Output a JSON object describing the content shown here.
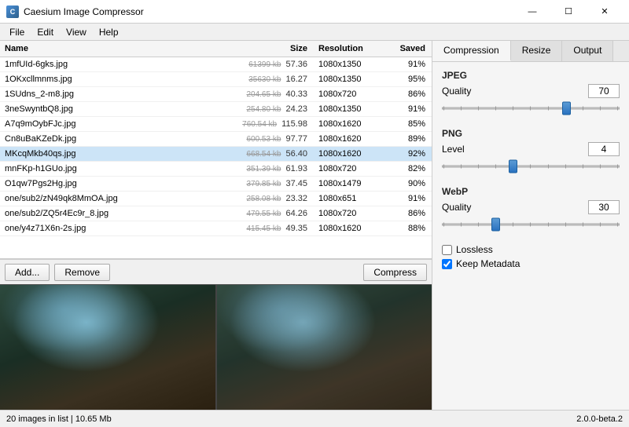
{
  "app": {
    "title": "Caesium Image Compressor",
    "version": "2.0.0-beta.2"
  },
  "titlebar": {
    "minimize": "—",
    "maximize": "☐",
    "close": "✕"
  },
  "menubar": {
    "items": [
      "File",
      "Edit",
      "View",
      "Help"
    ]
  },
  "filelist": {
    "headers": {
      "name": "Name",
      "size": "Size",
      "resolution": "Resolution",
      "saved": "Saved"
    },
    "files": [
      {
        "name": "1mfUId-6gks.jpg",
        "size_orig": "61399 kb",
        "size_new": "57.36",
        "resolution": "1080x1350",
        "saved": "91%"
      },
      {
        "name": "1OKxcllmnms.jpg",
        "size_orig": "35630 kb",
        "size_new": "16.27",
        "resolution": "1080x1350",
        "saved": "95%"
      },
      {
        "name": "1SUdns_2-m8.jpg",
        "size_orig": "204.65 kb",
        "size_new": "40.33",
        "resolution": "1080x720",
        "saved": "86%"
      },
      {
        "name": "3neSwyntbQ8.jpg",
        "size_orig": "254.80 kb",
        "size_new": "24.23",
        "resolution": "1080x1350",
        "saved": "91%"
      },
      {
        "name": "A7q9mOybFJc.jpg",
        "size_orig": "760.54 kb",
        "size_new": "115.98",
        "resolution": "1080x1620",
        "saved": "85%"
      },
      {
        "name": "Cn8uBaKZeDk.jpg",
        "size_orig": "600.53 kb",
        "size_new": "97.77",
        "resolution": "1080x1620",
        "saved": "89%"
      },
      {
        "name": "MKcqMkb40qs.jpg",
        "size_orig": "668.54 kb",
        "size_new": "56.40",
        "resolution": "1080x1620",
        "saved": "92%",
        "selected": true
      },
      {
        "name": "mnFKp-h1GUo.jpg",
        "size_orig": "351.39 kb",
        "size_new": "61.93",
        "resolution": "1080x720",
        "saved": "82%"
      },
      {
        "name": "O1qw7Pgs2Hg.jpg",
        "size_orig": "379.85 kb",
        "size_new": "37.45",
        "resolution": "1080x1479",
        "saved": "90%"
      },
      {
        "name": "one/sub2/zN49qk8MmOA.jpg",
        "size_orig": "258.08 kb",
        "size_new": "23.32",
        "resolution": "1080x651",
        "saved": "91%"
      },
      {
        "name": "one/sub2/ZQ5r4Ec9r_8.jpg",
        "size_orig": "479.55 kb",
        "size_new": "64.26",
        "resolution": "1080x720",
        "saved": "86%"
      },
      {
        "name": "one/y4z71X6n-2s.jpg",
        "size_orig": "415.45 kb",
        "size_new": "49.35",
        "resolution": "1080x1620",
        "saved": "88%"
      }
    ]
  },
  "toolbar": {
    "add_label": "Add...",
    "remove_label": "Remove",
    "compress_label": "Compress"
  },
  "tabs": {
    "compression_label": "Compression",
    "resize_label": "Resize",
    "output_label": "Output"
  },
  "compression": {
    "jpeg_title": "JPEG",
    "jpeg_quality_label": "Quality",
    "jpeg_quality_value": "70",
    "jpeg_slider_pct": 70,
    "png_title": "PNG",
    "png_level_label": "Level",
    "png_level_value": "4",
    "png_slider_pct": 40,
    "webp_title": "WebP",
    "webp_quality_label": "Quality",
    "webp_quality_value": "30",
    "webp_slider_pct": 30,
    "lossless_label": "Lossless",
    "lossless_checked": false,
    "keep_metadata_label": "Keep Metadata",
    "keep_metadata_checked": true
  },
  "statusbar": {
    "count_text": "20 images in list | 10.65 Mb",
    "version": "2.0.0-beta.2"
  }
}
